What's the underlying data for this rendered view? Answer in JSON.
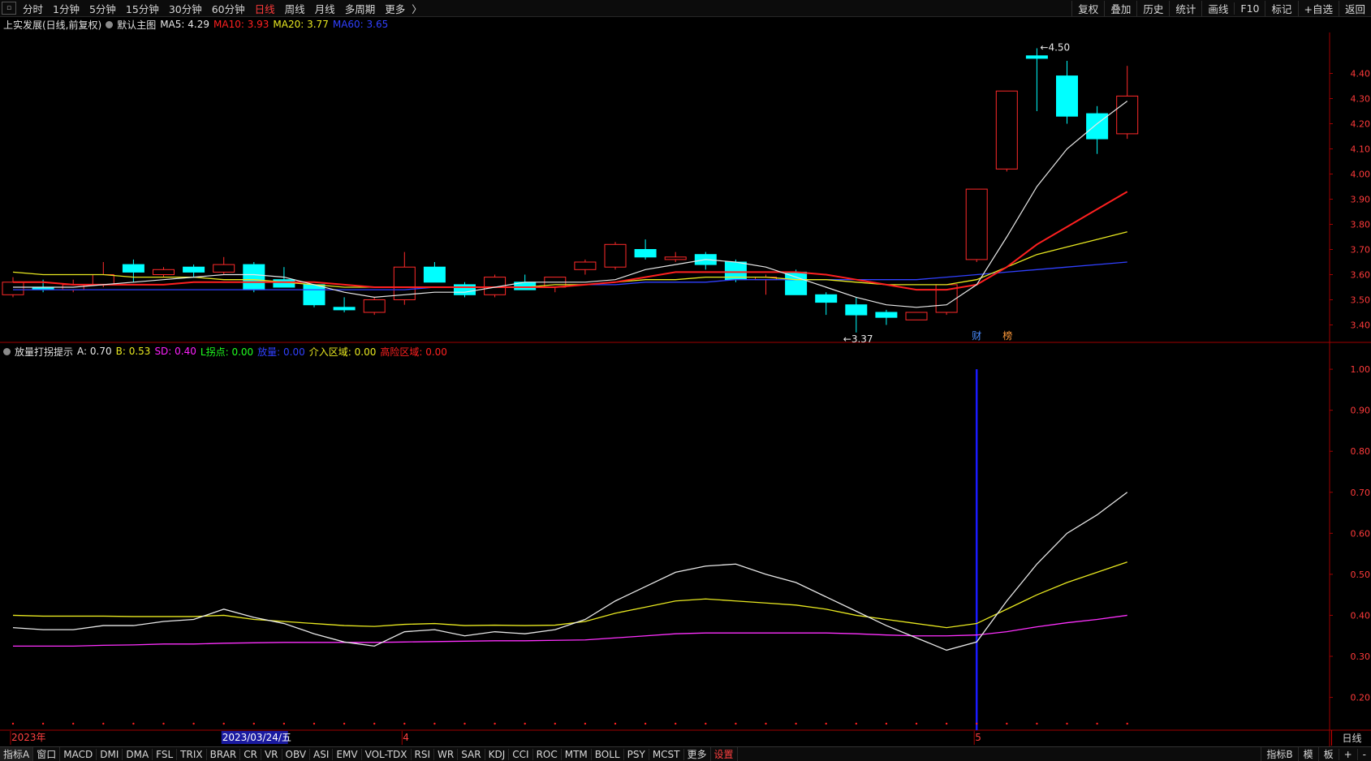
{
  "topbar": {
    "periods": [
      "分时",
      "1分钟",
      "5分钟",
      "15分钟",
      "30分钟",
      "60分钟",
      "日线",
      "周线",
      "月线",
      "多周期",
      "更多"
    ],
    "active_period": "日线",
    "more_arrow": "〉",
    "right_buttons": [
      "复权",
      "叠加",
      "历史",
      "统计",
      "画线",
      "F10",
      "标记",
      "+自选",
      "返回"
    ]
  },
  "main_panel": {
    "stock_title": "上实发展(日线,前复权)",
    "template_label": "默认主图",
    "ma5": {
      "label": "MA5:",
      "value": "4.29",
      "color": "#e8e8e8"
    },
    "ma10": {
      "label": "MA10:",
      "value": "3.93",
      "color": "#ff2020"
    },
    "ma20": {
      "label": "MA20:",
      "value": "3.77",
      "color": "#e8e820"
    },
    "ma60": {
      "label": "MA60:",
      "value": "3.65",
      "color": "#3040ff"
    },
    "high_label": "4.50",
    "low_label": "3.37",
    "badge_cai": "财",
    "badge_bang": "榜"
  },
  "sub_panel": {
    "indicator_name": "放量打拐提示",
    "a": {
      "label": "A:",
      "value": "0.70",
      "color": "#e8e8e8"
    },
    "b": {
      "label": "B:",
      "value": "0.53",
      "color": "#e8e820"
    },
    "sd": {
      "label": "SD:",
      "value": "0.40",
      "color": "#ff20ff"
    },
    "l_turn": {
      "label": "L拐点:",
      "value": "0.00",
      "color": "#20ff20"
    },
    "volume": {
      "label": "放量:",
      "value": "0.00",
      "color": "#3040ff"
    },
    "enter_zone": {
      "label": "介入区域:",
      "value": "0.00",
      "color": "#e8e820"
    },
    "risk_zone": {
      "label": "高险区域:",
      "value": "0.00",
      "color": "#ff2020"
    }
  },
  "x_axis": {
    "labels": [
      {
        "text": "2023年",
        "index": 0,
        "color": "#ff4040"
      },
      {
        "text": "2023/03/24/五",
        "index": 7,
        "color": "#ffffff",
        "highlight": true
      },
      {
        "text": "4",
        "index": 13,
        "color": "#ff4040"
      },
      {
        "text": "5",
        "index": 32,
        "color": "#ff4040"
      }
    ],
    "right_label": "日线"
  },
  "bottombar": {
    "tabs": [
      "指标A",
      "窗口",
      "MACD",
      "DMI",
      "DMA",
      "FSL",
      "TRIX",
      "BRAR",
      "CR",
      "VR",
      "OBV",
      "ASI",
      "EMV",
      "VOL-TDX",
      "RSI",
      "WR",
      "SAR",
      "KDJ",
      "CCI",
      "ROC",
      "MTM",
      "BOLL",
      "PSY",
      "MCST",
      "更多",
      "设置"
    ],
    "red_tabs": [
      "设置"
    ],
    "right_buttons": [
      "指标B",
      "模",
      "板",
      "+",
      "-"
    ]
  },
  "chart_data": [
    {
      "type": "candlestick",
      "ylim": [
        3.35,
        4.55
      ],
      "y_ticks": [
        3.4,
        3.5,
        3.6,
        3.7,
        3.8,
        3.9,
        4.0,
        4.1,
        4.2,
        4.3,
        4.4
      ],
      "ohlc": [
        {
          "o": 3.52,
          "h": 3.59,
          "l": 3.51,
          "c": 3.57
        },
        {
          "o": 3.55,
          "h": 3.58,
          "l": 3.53,
          "c": 3.54
        },
        {
          "o": 3.54,
          "h": 3.58,
          "l": 3.53,
          "c": 3.56
        },
        {
          "o": 3.56,
          "h": 3.65,
          "l": 3.55,
          "c": 3.6
        },
        {
          "o": 3.64,
          "h": 3.66,
          "l": 3.57,
          "c": 3.61
        },
        {
          "o": 3.6,
          "h": 3.63,
          "l": 3.59,
          "c": 3.62
        },
        {
          "o": 3.63,
          "h": 3.64,
          "l": 3.59,
          "c": 3.61
        },
        {
          "o": 3.61,
          "h": 3.67,
          "l": 3.6,
          "c": 3.64
        },
        {
          "o": 3.64,
          "h": 3.65,
          "l": 3.53,
          "c": 3.54
        },
        {
          "o": 3.58,
          "h": 3.63,
          "l": 3.56,
          "c": 3.55
        },
        {
          "o": 3.56,
          "h": 3.56,
          "l": 3.47,
          "c": 3.48
        },
        {
          "o": 3.47,
          "h": 3.51,
          "l": 3.45,
          "c": 3.46
        },
        {
          "o": 3.45,
          "h": 3.51,
          "l": 3.44,
          "c": 3.5
        },
        {
          "o": 3.5,
          "h": 3.69,
          "l": 3.48,
          "c": 3.63
        },
        {
          "o": 3.63,
          "h": 3.65,
          "l": 3.57,
          "c": 3.57
        },
        {
          "o": 3.56,
          "h": 3.57,
          "l": 3.51,
          "c": 3.52
        },
        {
          "o": 3.52,
          "h": 3.6,
          "l": 3.51,
          "c": 3.59
        },
        {
          "o": 3.57,
          "h": 3.6,
          "l": 3.54,
          "c": 3.54
        },
        {
          "o": 3.55,
          "h": 3.59,
          "l": 3.53,
          "c": 3.59
        },
        {
          "o": 3.62,
          "h": 3.66,
          "l": 3.6,
          "c": 3.65
        },
        {
          "o": 3.63,
          "h": 3.73,
          "l": 3.62,
          "c": 3.72
        },
        {
          "o": 3.7,
          "h": 3.74,
          "l": 3.66,
          "c": 3.67
        },
        {
          "o": 3.66,
          "h": 3.69,
          "l": 3.65,
          "c": 3.67
        },
        {
          "o": 3.68,
          "h": 3.69,
          "l": 3.62,
          "c": 3.64
        },
        {
          "o": 3.65,
          "h": 3.66,
          "l": 3.57,
          "c": 3.58
        },
        {
          "o": 3.58,
          "h": 3.6,
          "l": 3.52,
          "c": 3.59
        },
        {
          "o": 3.61,
          "h": 3.62,
          "l": 3.52,
          "c": 3.52
        },
        {
          "o": 3.52,
          "h": 3.53,
          "l": 3.44,
          "c": 3.49
        },
        {
          "o": 3.48,
          "h": 3.51,
          "l": 3.37,
          "c": 3.44
        },
        {
          "o": 3.45,
          "h": 3.46,
          "l": 3.4,
          "c": 3.43
        },
        {
          "o": 3.42,
          "h": 3.45,
          "l": 3.42,
          "c": 3.45
        },
        {
          "o": 3.45,
          "h": 3.56,
          "l": 3.44,
          "c": 3.56
        },
        {
          "o": 3.66,
          "h": 3.94,
          "l": 3.65,
          "c": 3.94
        },
        {
          "o": 4.02,
          "h": 4.33,
          "l": 4.01,
          "c": 4.33
        },
        {
          "o": 4.47,
          "h": 4.5,
          "l": 4.25,
          "c": 4.46
        },
        {
          "o": 4.39,
          "h": 4.45,
          "l": 4.2,
          "c": 4.23
        },
        {
          "o": 4.24,
          "h": 4.27,
          "l": 4.08,
          "c": 4.14
        },
        {
          "o": 4.16,
          "h": 4.43,
          "l": 4.14,
          "c": 4.31
        }
      ],
      "ma5": [
        3.55,
        3.55,
        3.55,
        3.56,
        3.57,
        3.58,
        3.59,
        3.6,
        3.6,
        3.59,
        3.56,
        3.53,
        3.51,
        3.52,
        3.53,
        3.53,
        3.55,
        3.57,
        3.57,
        3.57,
        3.58,
        3.62,
        3.64,
        3.66,
        3.65,
        3.63,
        3.59,
        3.55,
        3.51,
        3.48,
        3.47,
        3.48,
        3.56,
        3.75,
        3.95,
        4.1,
        4.2,
        4.29
      ],
      "ma10": [
        3.57,
        3.57,
        3.56,
        3.56,
        3.56,
        3.56,
        3.57,
        3.57,
        3.57,
        3.57,
        3.57,
        3.56,
        3.55,
        3.55,
        3.55,
        3.55,
        3.55,
        3.55,
        3.55,
        3.56,
        3.57,
        3.59,
        3.61,
        3.61,
        3.61,
        3.61,
        3.61,
        3.6,
        3.58,
        3.56,
        3.54,
        3.54,
        3.56,
        3.63,
        3.72,
        3.79,
        3.86,
        3.93
      ],
      "ma20": [
        3.61,
        3.6,
        3.6,
        3.6,
        3.59,
        3.59,
        3.59,
        3.58,
        3.58,
        3.57,
        3.56,
        3.55,
        3.55,
        3.55,
        3.55,
        3.55,
        3.55,
        3.55,
        3.56,
        3.56,
        3.57,
        3.58,
        3.58,
        3.59,
        3.59,
        3.59,
        3.58,
        3.58,
        3.57,
        3.56,
        3.56,
        3.56,
        3.58,
        3.63,
        3.68,
        3.71,
        3.74,
        3.77
      ],
      "ma60": [
        3.54,
        3.54,
        3.54,
        3.54,
        3.54,
        3.54,
        3.54,
        3.54,
        3.54,
        3.54,
        3.54,
        3.54,
        3.54,
        3.54,
        3.55,
        3.55,
        3.55,
        3.55,
        3.55,
        3.56,
        3.56,
        3.57,
        3.57,
        3.57,
        3.58,
        3.58,
        3.58,
        3.58,
        3.58,
        3.58,
        3.58,
        3.59,
        3.6,
        3.61,
        3.62,
        3.63,
        3.64,
        3.65
      ],
      "high_index": 34,
      "low_index": 28,
      "badge_index": 32
    },
    {
      "type": "line",
      "ylim": [
        0.12,
        1.02
      ],
      "y_ticks": [
        0.2,
        0.3,
        0.4,
        0.5,
        0.6,
        0.7,
        0.8,
        0.9,
        1.0
      ],
      "series": [
        {
          "name": "A",
          "color": "#e8e8e8",
          "values": [
            0.37,
            0.365,
            0.365,
            0.375,
            0.375,
            0.385,
            0.39,
            0.415,
            0.395,
            0.38,
            0.355,
            0.335,
            0.325,
            0.36,
            0.365,
            0.35,
            0.36,
            0.355,
            0.365,
            0.39,
            0.435,
            0.47,
            0.505,
            0.52,
            0.525,
            0.5,
            0.48,
            0.445,
            0.41,
            0.375,
            0.345,
            0.315,
            0.335,
            0.435,
            0.525,
            0.6,
            0.645,
            0.7
          ]
        },
        {
          "name": "B",
          "color": "#e8e820",
          "values": [
            0.4,
            0.398,
            0.398,
            0.398,
            0.397,
            0.397,
            0.397,
            0.4,
            0.39,
            0.385,
            0.38,
            0.375,
            0.373,
            0.378,
            0.38,
            0.375,
            0.376,
            0.375,
            0.376,
            0.385,
            0.405,
            0.42,
            0.435,
            0.44,
            0.435,
            0.43,
            0.425,
            0.415,
            0.4,
            0.39,
            0.38,
            0.37,
            0.38,
            0.415,
            0.45,
            0.48,
            0.505,
            0.53
          ]
        },
        {
          "name": "SD",
          "color": "#ff30ff",
          "values": [
            0.325,
            0.325,
            0.325,
            0.327,
            0.328,
            0.33,
            0.33,
            0.332,
            0.333,
            0.334,
            0.334,
            0.334,
            0.334,
            0.335,
            0.336,
            0.337,
            0.338,
            0.338,
            0.339,
            0.34,
            0.345,
            0.35,
            0.355,
            0.357,
            0.357,
            0.357,
            0.357,
            0.357,
            0.355,
            0.352,
            0.35,
            0.35,
            0.352,
            0.36,
            0.372,
            0.382,
            0.39,
            0.4
          ]
        }
      ],
      "vertical_signal_index": 32,
      "vertical_signal_color": "#1a1aff"
    }
  ]
}
